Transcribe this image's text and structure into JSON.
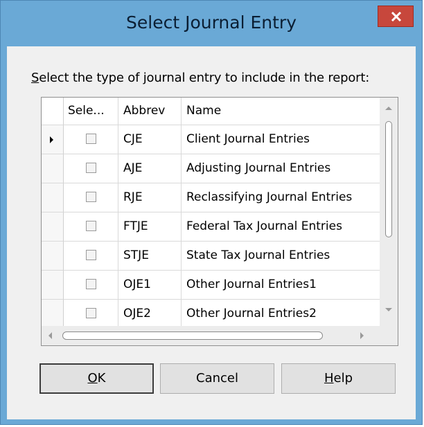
{
  "window": {
    "title": "Select Journal Entry"
  },
  "prompt": {
    "mnemonic": "S",
    "rest": "elect the type of journal entry to include in the report:"
  },
  "grid": {
    "columns": [
      "Sele...",
      "Abbrev",
      "Name"
    ],
    "rows": [
      {
        "selected": false,
        "abbrev": "CJE",
        "name": "Client Journal Entries",
        "current": true
      },
      {
        "selected": false,
        "abbrev": "AJE",
        "name": "Adjusting Journal Entries",
        "current": false
      },
      {
        "selected": false,
        "abbrev": "RJE",
        "name": "Reclassifying Journal Entries",
        "current": false
      },
      {
        "selected": false,
        "abbrev": "FTJE",
        "name": "Federal Tax Journal Entries",
        "current": false
      },
      {
        "selected": false,
        "abbrev": "STJE",
        "name": "State Tax Journal Entries",
        "current": false
      },
      {
        "selected": false,
        "abbrev": "OJE1",
        "name": "Other Journal Entries1",
        "current": false
      },
      {
        "selected": false,
        "abbrev": "OJE2",
        "name": "Other Journal Entries2",
        "current": false
      }
    ]
  },
  "buttons": {
    "ok": {
      "mnemonic": "O",
      "rest": "K"
    },
    "cancel": {
      "label": "Cancel"
    },
    "help": {
      "mnemonic": "H",
      "rest": "elp"
    }
  },
  "colors": {
    "titlebar": "#6aa9d6",
    "close": "#c7473c",
    "client": "#f0f0f0"
  },
  "icons": {
    "close": "close-icon",
    "current_row": "row-indicator-icon"
  }
}
